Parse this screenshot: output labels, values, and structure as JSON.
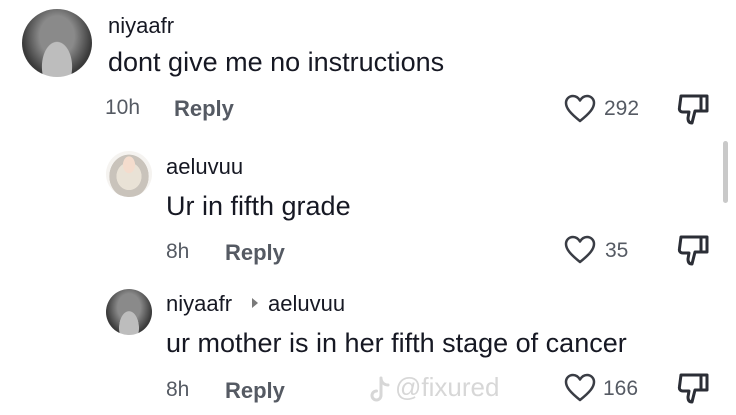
{
  "comments": [
    {
      "username": "niyaafr",
      "text": "dont give me no instructions",
      "time": "10h",
      "reply_label": "Reply",
      "likes": "292"
    },
    {
      "username": "aeluvuu",
      "text": "Ur in fifth grade",
      "time": "8h",
      "reply_label": "Reply",
      "likes": "35"
    },
    {
      "username": "niyaafr",
      "reply_to": "aeluvuu",
      "text": "ur mother is in her fifth stage of cancer",
      "time": "8h",
      "reply_label": "Reply",
      "likes": "166"
    }
  ],
  "watermark": "@fixured",
  "icons": [
    "heart-outline-icon",
    "dislike-icon",
    "tiktok-logo-icon",
    "reply-arrow-icon"
  ]
}
